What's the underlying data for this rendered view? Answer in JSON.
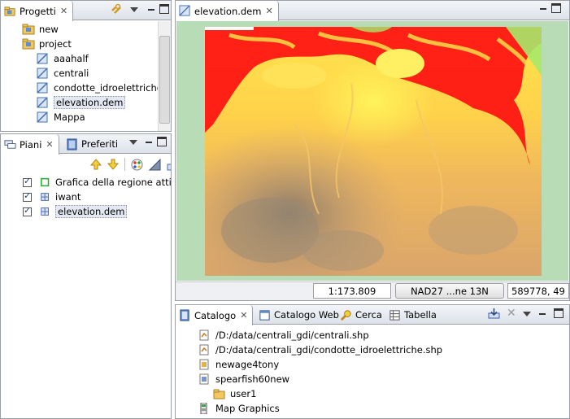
{
  "projects": {
    "tab_label": "Progetti",
    "items": [
      {
        "label": "new"
      },
      {
        "label": "project"
      },
      {
        "label": "aaahalf"
      },
      {
        "label": "centrali"
      },
      {
        "label": "condotte_idroelettriche"
      },
      {
        "label": "elevation.dem"
      },
      {
        "label": "Mappa"
      }
    ]
  },
  "layers": {
    "tab_label": "Piani",
    "tab2_label": "Preferiti",
    "items": [
      {
        "label": "Grafica della regione attiva"
      },
      {
        "label": "iwant"
      },
      {
        "label": "elevation.dem"
      }
    ]
  },
  "editor": {
    "tab_label": "elevation.dem",
    "status": {
      "scale": "1:173.809",
      "crs": "NAD27 ...ne 13N",
      "coords": "589778, 49"
    }
  },
  "catalog": {
    "tabs": [
      "Catalogo",
      "Catalogo Web",
      "Cerca",
      "Tabella"
    ],
    "items": [
      {
        "label": "/D:/data/centrali_gdi/centrali.shp"
      },
      {
        "label": "/D:/data/centrali_gdi/condotte_idroelettriche.shp"
      },
      {
        "label": "newage4tony"
      },
      {
        "label": "spearfish60new"
      },
      {
        "label": "user1"
      },
      {
        "label": "Map Graphics"
      }
    ]
  },
  "colors": {
    "map_bg": "#b8dcb6",
    "elevation_high": "#ff0000",
    "elevation_mid": "#ffd94a",
    "elevation_low": "#8a7a6a",
    "accent": "#1d3f8a"
  }
}
